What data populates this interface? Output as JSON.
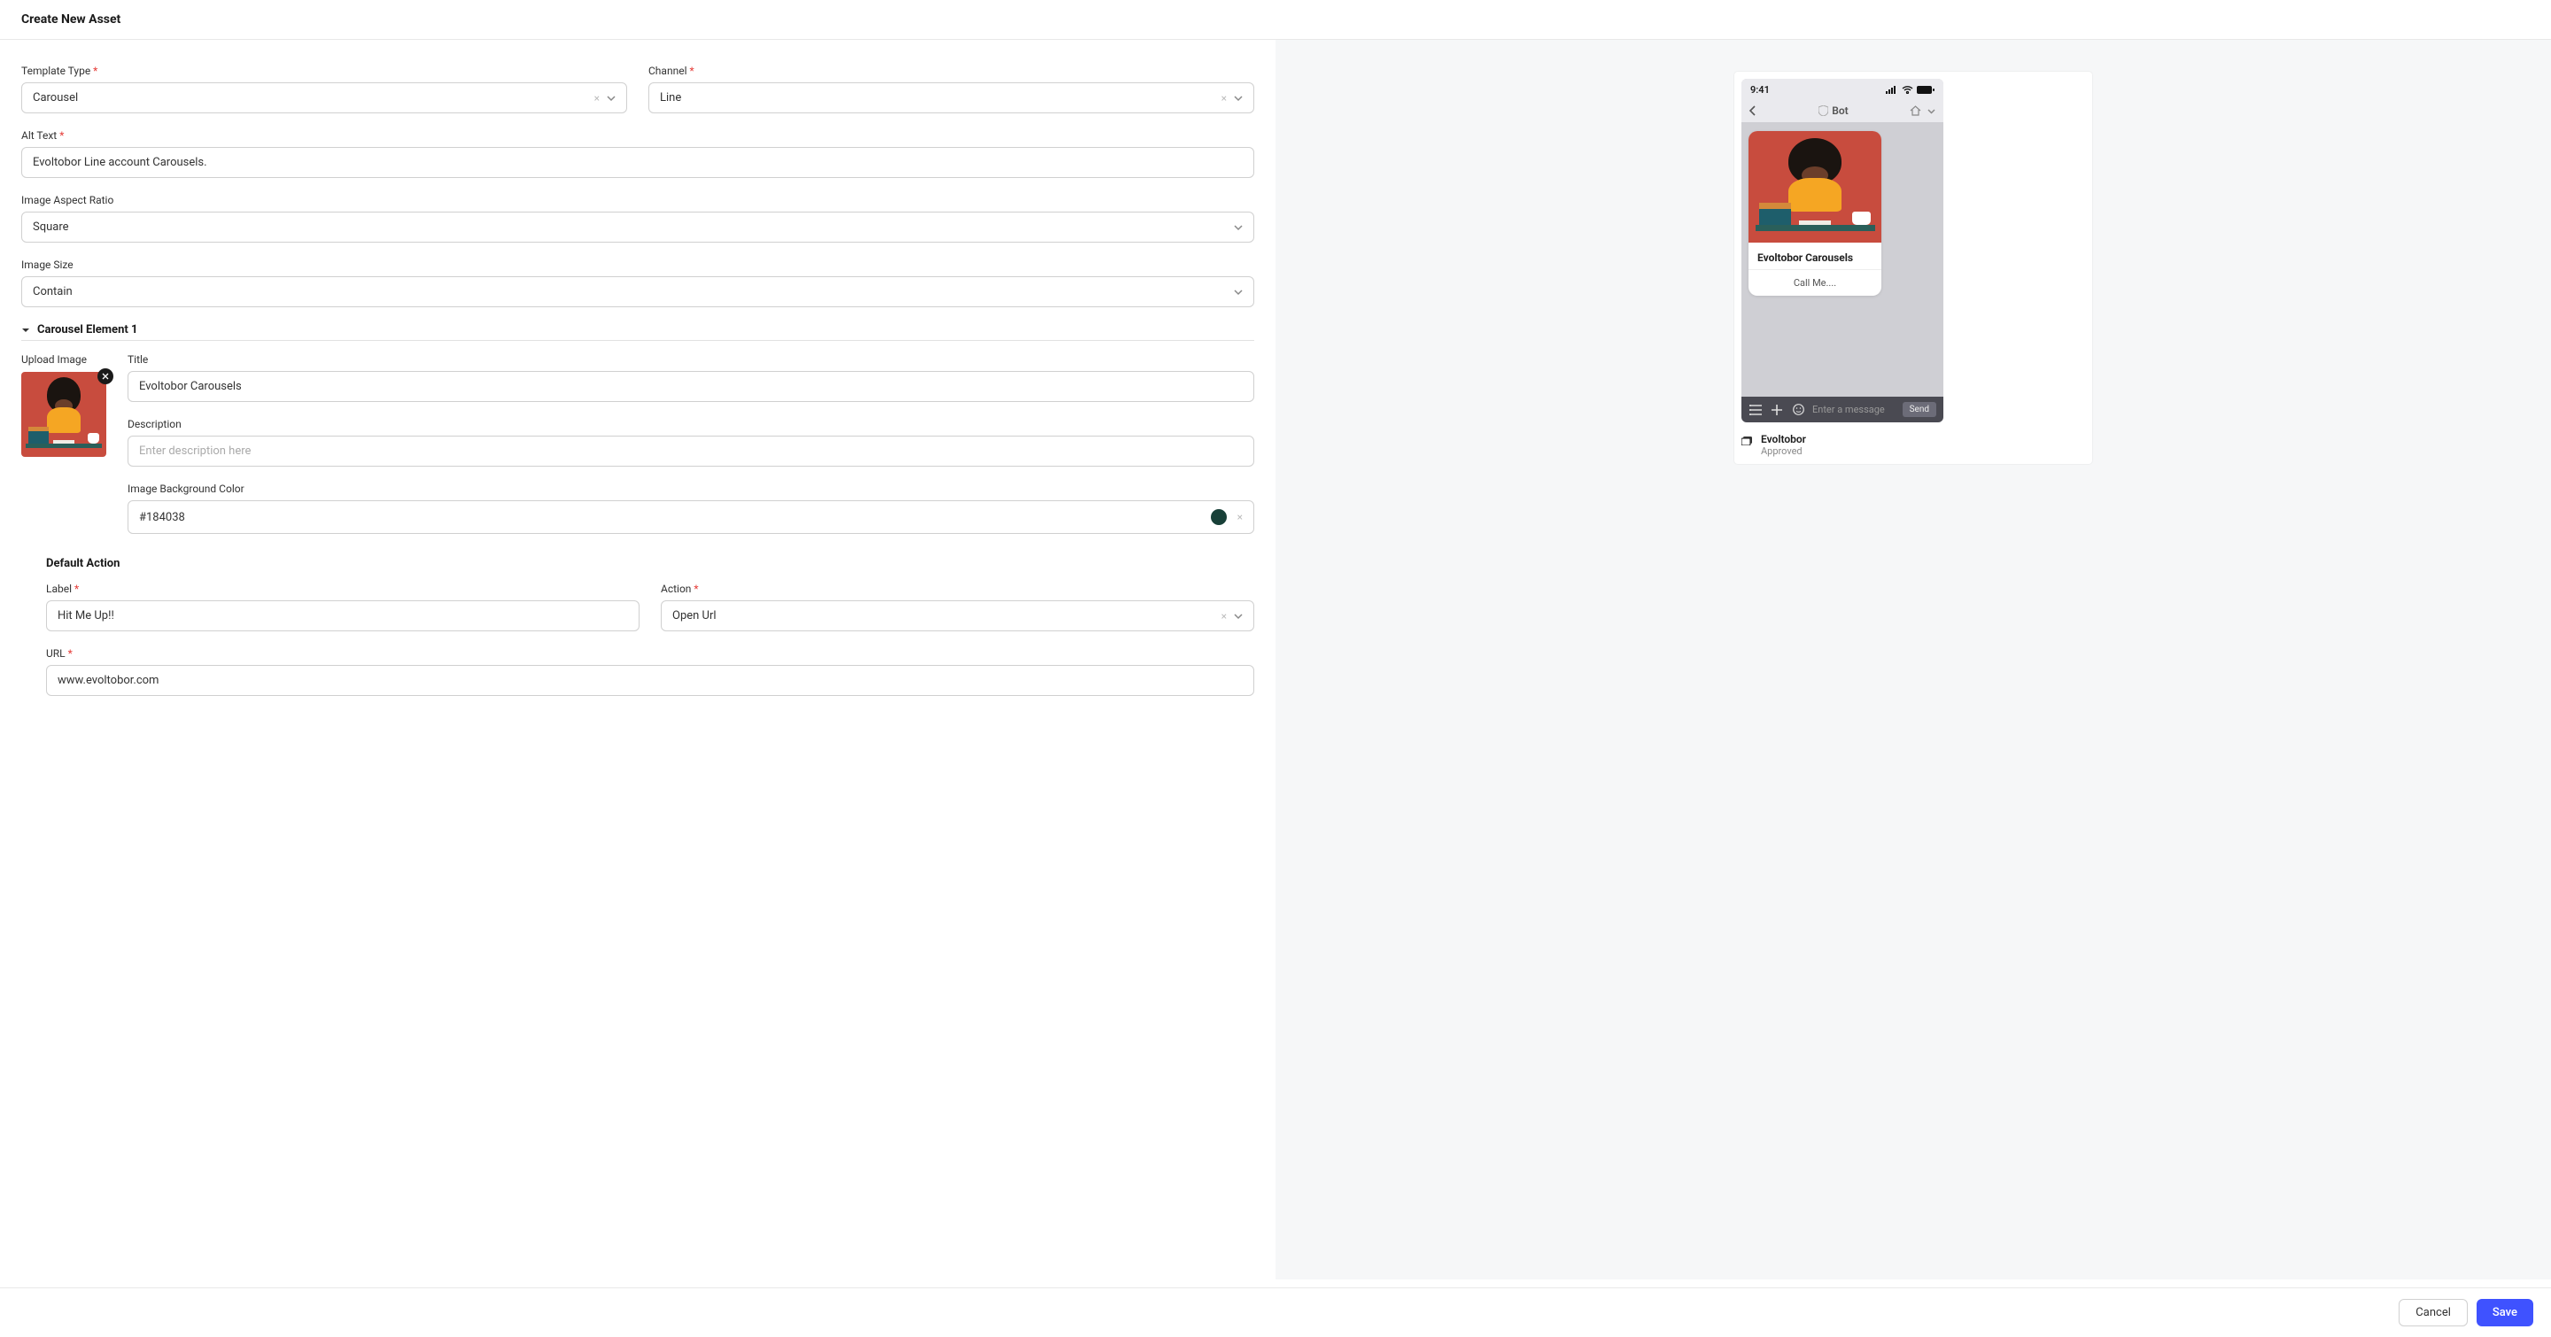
{
  "header": {
    "title": "Create New Asset"
  },
  "form": {
    "templateType": {
      "label": "Template Type",
      "value": "Carousel"
    },
    "channel": {
      "label": "Channel",
      "value": "Line"
    },
    "altText": {
      "label": "Alt Text",
      "value": "Evoltobor Line account Carousels."
    },
    "aspectRatio": {
      "label": "Image Aspect Ratio",
      "value": "Square"
    },
    "imageSize": {
      "label": "Image Size",
      "value": "Contain"
    }
  },
  "carousel": {
    "sectionTitle": "Carousel Element 1",
    "uploadLabel": "Upload Image",
    "title": {
      "label": "Title",
      "value": "Evoltobor Carousels"
    },
    "description": {
      "label": "Description",
      "placeholder": "Enter description here",
      "value": ""
    },
    "bgColor": {
      "label": "Image Background Color",
      "value": "#184038",
      "swatch": "#184038"
    }
  },
  "defaultAction": {
    "header": "Default Action",
    "labelField": {
      "label": "Label",
      "value": "Hit Me Up!!"
    },
    "actionField": {
      "label": "Action",
      "value": "Open Url"
    },
    "urlField": {
      "label": "URL",
      "value": "www.evoltobor.com"
    }
  },
  "preview": {
    "time": "9:41",
    "botLabel": "Bot",
    "cardTitle": "Evoltobor Carousels",
    "cardButton": "Call Me....",
    "composerPlaceholder": "Enter a message",
    "sendLabel": "Send",
    "metaName": "Evoltobor",
    "metaStatus": "Approved"
  },
  "footer": {
    "cancel": "Cancel",
    "save": "Save"
  }
}
